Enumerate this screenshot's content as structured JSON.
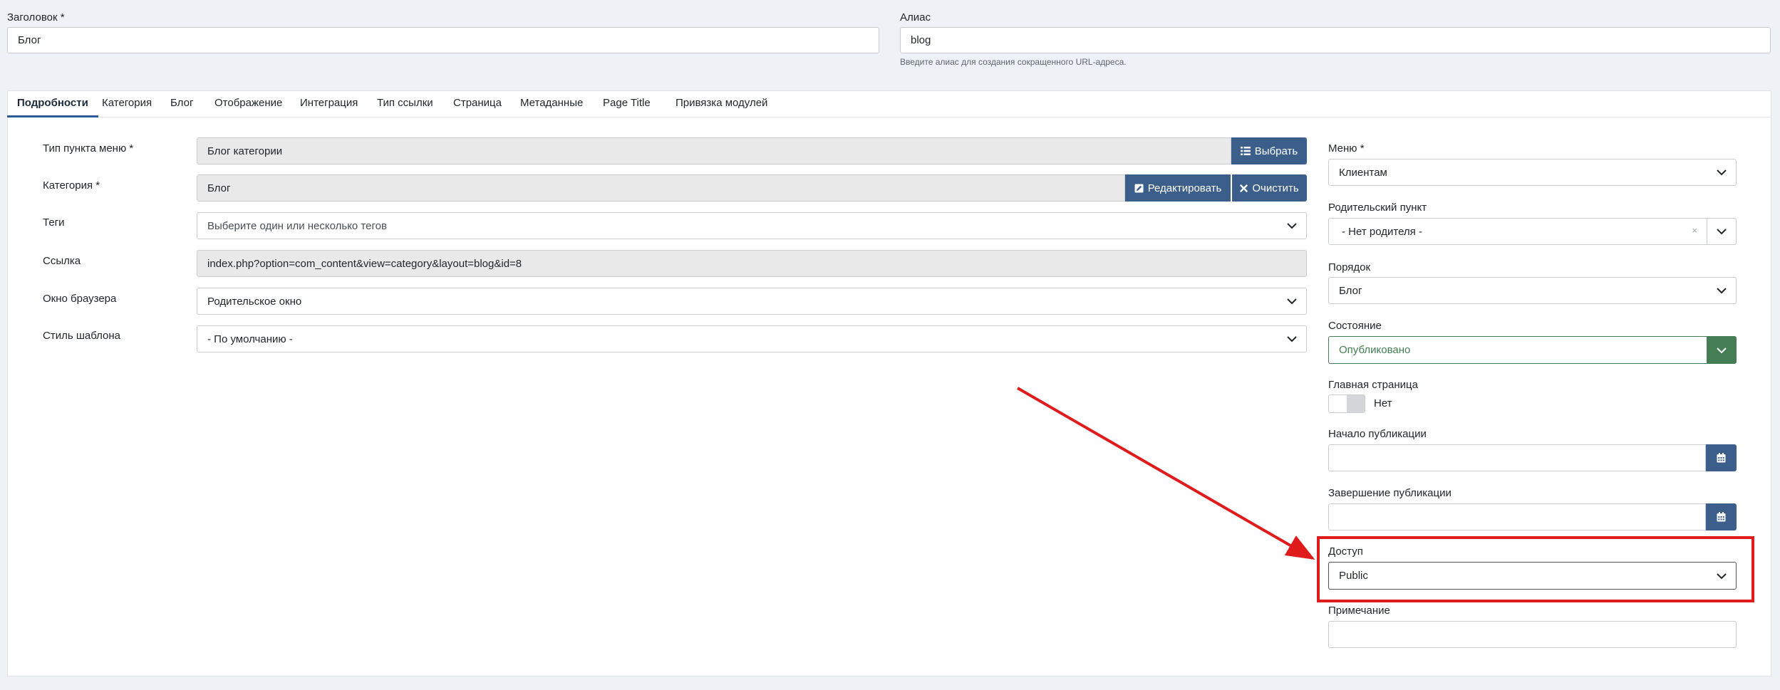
{
  "top": {
    "title_label": "Заголовок *",
    "title_value": "Блог",
    "alias_label": "Алиас",
    "alias_value": "blog",
    "alias_help": "Введите алиас для создания сокращенного URL-адреса."
  },
  "tabs": [
    {
      "label": "Подробности"
    },
    {
      "label": "Категория"
    },
    {
      "label": "Блог"
    },
    {
      "label": "Отображение"
    },
    {
      "label": "Интеграция"
    },
    {
      "label": "Тип ссылки"
    },
    {
      "label": "Страница"
    },
    {
      "label": "Метаданные"
    },
    {
      "label": "Page Title"
    },
    {
      "label": "Привязка модулей"
    }
  ],
  "details": {
    "menu_type_label": "Тип пункта меню *",
    "menu_type_value": "Блог категории",
    "select_button": "Выбрать",
    "category_label": "Категория *",
    "category_value": "Блог",
    "edit_button": "Редактировать",
    "clear_button": "Очистить",
    "tags_label": "Теги",
    "tags_placeholder": "Выберите один или несколько тегов",
    "link_label": "Ссылка",
    "link_value": "index.php?option=com_content&view=category&layout=blog&id=8",
    "browser_label": "Окно браузера",
    "browser_value": "Родительское окно",
    "template_label": "Стиль шаблона",
    "template_value": "- По умолчанию -"
  },
  "sidebar": {
    "menu_label": "Меню *",
    "menu_value": "Клиентам",
    "parent_label": "Родительский пункт",
    "parent_value": "- Нет родителя -",
    "order_label": "Порядок",
    "order_value": "Блог",
    "state_label": "Состояние",
    "state_value": "Опубликовано",
    "home_label": "Главная страница",
    "home_value": "Нет",
    "publish_up_label": "Начало публикации",
    "publish_down_label": "Завершение публикации",
    "access_label": "Доступ",
    "access_value": "Public",
    "note_label": "Примечание"
  },
  "colors": {
    "accent": "#3b5f8a",
    "published": "#457d54",
    "annotation": "#e01b1b"
  }
}
